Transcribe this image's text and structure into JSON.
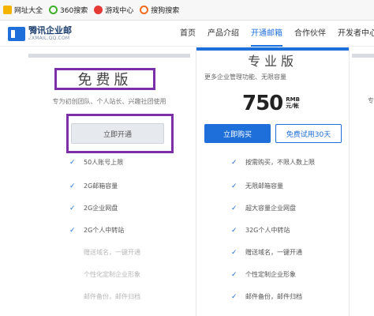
{
  "bookmarks": [
    {
      "label": "网址大全",
      "icon": "sites-icon"
    },
    {
      "label": "360搜索",
      "icon": "360-icon"
    },
    {
      "label": "游戏中心",
      "icon": "game-icon"
    },
    {
      "label": "搜狗搜索",
      "icon": "sogou-icon"
    }
  ],
  "header": {
    "logo_cn": "腾讯企业邮",
    "logo_en": "EXMAIL.QQ.COM",
    "nav": [
      "首页",
      "产品介绍",
      "开通邮箱",
      "合作伙伴",
      "开发者中心"
    ],
    "active_nav": "开通邮箱"
  },
  "free_plan": {
    "title": "免费版",
    "subtitle": "专为初创团队、个人站长、兴趣社团使用",
    "open_label": "立即开通",
    "features": [
      {
        "text": "50人账号上限",
        "enabled": true
      },
      {
        "text": "2G邮箱容量",
        "enabled": true
      },
      {
        "text": "2G企业网盘",
        "enabled": true
      },
      {
        "text": "2G个人中转站",
        "enabled": true
      },
      {
        "text": "赠送域名，一键开通",
        "enabled": false
      },
      {
        "text": "个性化定制企业形象",
        "enabled": false
      },
      {
        "text": "邮件备份，邮件归档",
        "enabled": false
      }
    ]
  },
  "pro_plan": {
    "title": "专业版",
    "subtitle": "更多企业管理功能、无限容量",
    "price": "750",
    "price_unit_top": "RMB",
    "price_unit_bottom": "元/帐",
    "buy_label": "立即购买",
    "trial_label": "免费试用30天",
    "features": [
      "按需购买，不限人数上限",
      "无限邮箱容量",
      "超大容量企业网盘",
      "32G个人中转站",
      "赠送域名，一键开通",
      "个性定制企业形象",
      "邮件备份，邮件归档"
    ]
  },
  "right_peek": {
    "subtitle": "专"
  },
  "colors": {
    "accent": "#1e6fd9",
    "highlight_box": "#7b2fa8"
  }
}
